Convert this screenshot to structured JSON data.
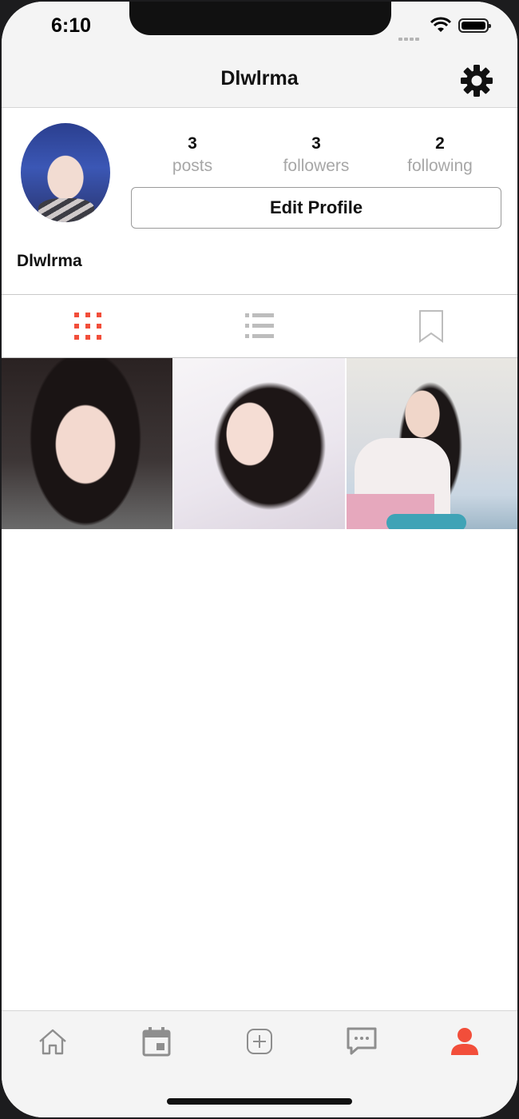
{
  "status_bar": {
    "time": "6:10"
  },
  "header": {
    "title": "Dlwlrma"
  },
  "profile": {
    "stats": [
      {
        "value": "3",
        "label": "posts"
      },
      {
        "value": "3",
        "label": "followers"
      },
      {
        "value": "2",
        "label": "following"
      }
    ],
    "edit_button": "Edit Profile",
    "username": "Dlwlrma"
  },
  "tabs": {
    "active": "grid",
    "items": [
      "grid-icon",
      "list-icon",
      "bookmark-icon"
    ]
  },
  "nav": {
    "active": "profile",
    "items": [
      "home-icon",
      "calendar-icon",
      "add-icon",
      "chat-icon",
      "profile-icon"
    ]
  },
  "colors": {
    "accent": "#f24e3a",
    "inactive": "#8e8e8e"
  }
}
